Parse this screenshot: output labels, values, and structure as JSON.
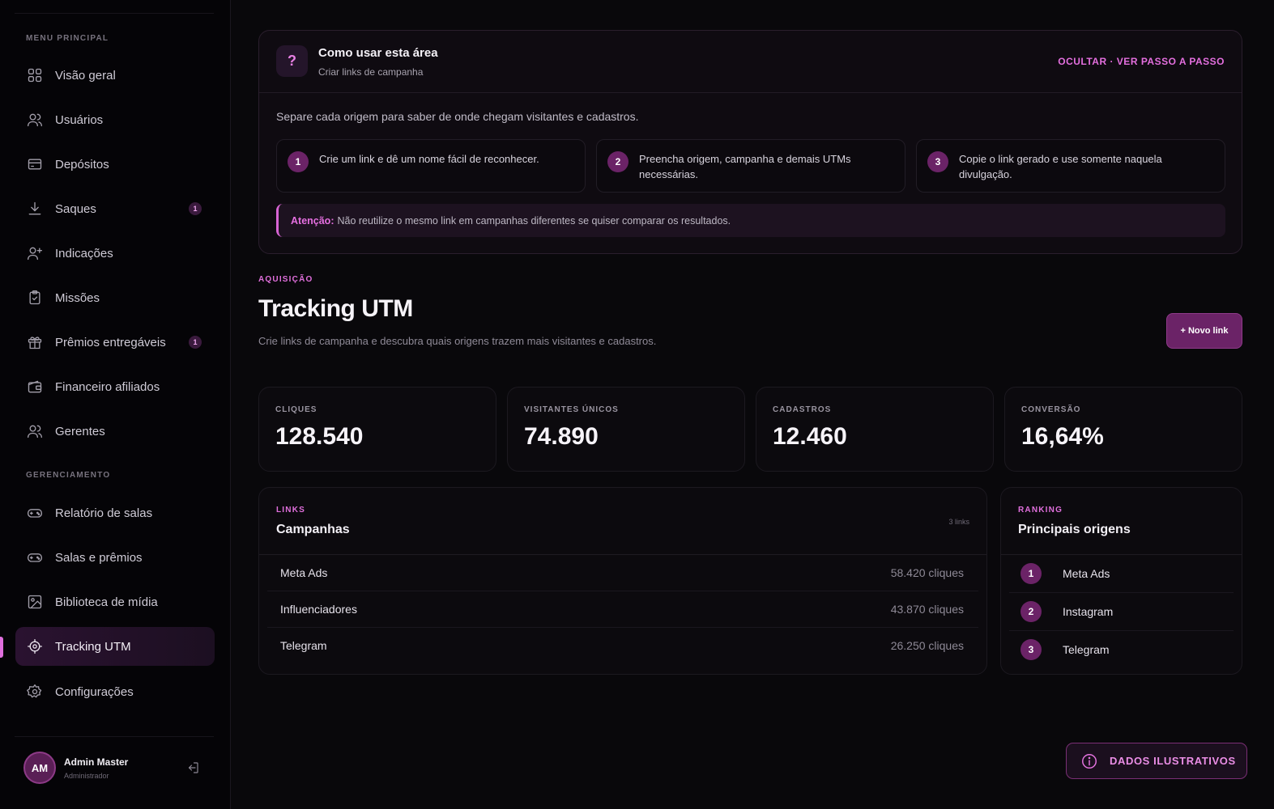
{
  "sidebar": {
    "section_main": "MENU PRINCIPAL",
    "section_manage": "GERENCIAMENTO",
    "items": [
      {
        "label": "Visão geral",
        "icon": "grid-icon"
      },
      {
        "label": "Usuários",
        "icon": "users-icon"
      },
      {
        "label": "Depósitos",
        "icon": "card-icon"
      },
      {
        "label": "Saques",
        "icon": "download-icon",
        "badge": "1"
      },
      {
        "label": "Indicações",
        "icon": "user-plus-icon"
      },
      {
        "label": "Missões",
        "icon": "clipboard-icon"
      },
      {
        "label": "Prêmios entregáveis",
        "icon": "gift-icon",
        "badge": "1"
      },
      {
        "label": "Financeiro afiliados",
        "icon": "wallet-icon"
      },
      {
        "label": "Gerentes",
        "icon": "users-icon"
      },
      {
        "label": "Relatório de salas",
        "icon": "gamepad-icon"
      },
      {
        "label": "Salas e prêmios",
        "icon": "gamepad-icon"
      },
      {
        "label": "Biblioteca de mídia",
        "icon": "image-icon"
      },
      {
        "label": "Tracking UTM",
        "icon": "target-icon",
        "active": true
      },
      {
        "label": "Configurações",
        "icon": "gear-icon"
      }
    ],
    "user": {
      "initials": "AM",
      "name": "Admin Master",
      "role": "Administrador"
    }
  },
  "help": {
    "icon": "?",
    "title": "Como usar esta área",
    "subtitle": "Criar links de campanha",
    "action": "OCULTAR · VER PASSO A PASSO",
    "description": "Separe cada origem para saber de onde chegam visitantes e cadastros.",
    "steps": [
      {
        "num": "1",
        "text": "Crie um link e dê um nome fácil de reconhecer."
      },
      {
        "num": "2",
        "text": "Preencha origem, campanha e demais UTMs necessárias."
      },
      {
        "num": "3",
        "text": "Copie o link gerado e use somente naquela divulgação."
      }
    ],
    "warning_label": "Atenção:",
    "warning_text": "Não reutilize o mesmo link em campanhas diferentes se quiser comparar os resultados."
  },
  "page": {
    "eyebrow": "AQUISIÇÃO",
    "title": "Tracking UTM",
    "subtitle": "Crie links de campanha e descubra quais origens trazem mais visitantes e cadastros.",
    "new_button": "+ Novo link"
  },
  "stats": [
    {
      "label": "CLIQUES",
      "value": "128.540"
    },
    {
      "label": "VISITANTES ÚNICOS",
      "value": "74.890"
    },
    {
      "label": "CADASTROS",
      "value": "12.460"
    },
    {
      "label": "CONVERSÃO",
      "value": "16,64%"
    }
  ],
  "campaigns": {
    "eyebrow": "LINKS",
    "title": "Campanhas",
    "count": "3 links",
    "rows": [
      {
        "name": "Meta Ads",
        "clicks": "58.420 cliques"
      },
      {
        "name": "Influenciadores",
        "clicks": "43.870 cliques"
      },
      {
        "name": "Telegram",
        "clicks": "26.250 cliques"
      }
    ]
  },
  "ranking": {
    "eyebrow": "RANKING",
    "title": "Principais origens",
    "rows": [
      {
        "num": "1",
        "name": "Meta Ads"
      },
      {
        "num": "2",
        "name": "Instagram"
      },
      {
        "num": "3",
        "name": "Telegram"
      }
    ]
  },
  "demo_badge": "DADOS ILUSTRATIVOS",
  "colors": {
    "accent": "#e06fdc",
    "accent_dark": "#6b2367",
    "background": "#09080b"
  }
}
